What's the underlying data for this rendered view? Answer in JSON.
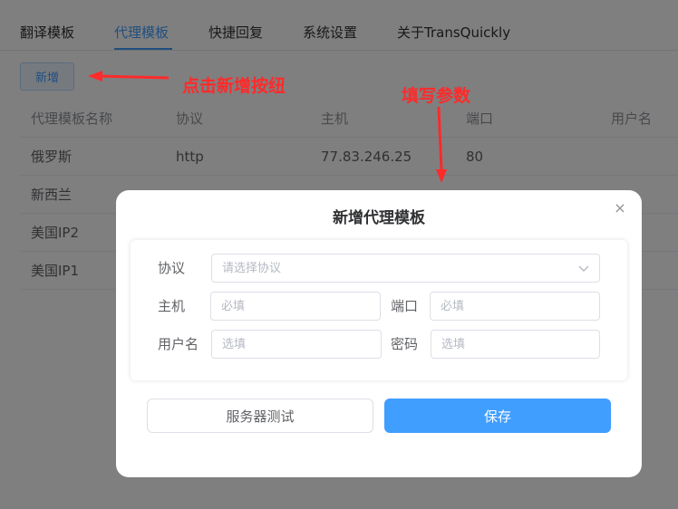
{
  "tabs": [
    {
      "label": "翻译模板",
      "active": false
    },
    {
      "label": "代理模板",
      "active": true
    },
    {
      "label": "快捷回复",
      "active": false
    },
    {
      "label": "系统设置",
      "active": false
    },
    {
      "label": "关于TransQuickly",
      "active": false
    }
  ],
  "add_button": "新增",
  "table": {
    "columns": [
      "代理模板名称",
      "协议",
      "主机",
      "端口",
      "用户名"
    ],
    "rows": [
      [
        "俄罗斯",
        "http",
        "77.83.246.25",
        "80",
        ""
      ],
      [
        "新西兰",
        "",
        "",
        "",
        ""
      ],
      [
        "美国IP2",
        "",
        "",
        "",
        ""
      ],
      [
        "美国IP1",
        "",
        "",
        "",
        ""
      ]
    ]
  },
  "annotations": {
    "click_add": "点击新增按纽",
    "fill_params": "填写参数",
    "color": "#ff2a2a"
  },
  "dialog": {
    "title": "新增代理模板",
    "close_icon": "×",
    "protocol_label": "协议",
    "protocol_placeholder": "请选择协议",
    "host_label": "主机",
    "host_placeholder": "必填",
    "port_label": "端口",
    "port_placeholder": "必填",
    "username_label": "用户名",
    "username_placeholder": "选填",
    "password_label": "密码",
    "password_placeholder": "选填",
    "test_button": "服务器测试",
    "save_button": "保存"
  },
  "colors": {
    "accent": "#409eff",
    "annotation": "#ff2a2a"
  }
}
